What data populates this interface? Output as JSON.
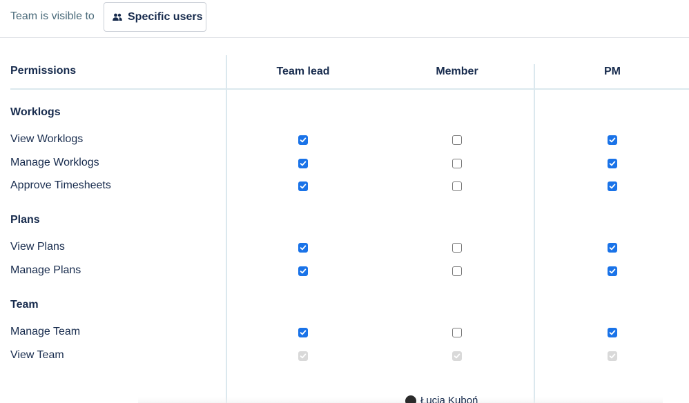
{
  "visibility": {
    "label": "Team is visible to",
    "button_label": "Specific users",
    "button_icon": "users-icon"
  },
  "table": {
    "header": {
      "permissions": "Permissions",
      "columns": [
        "Team lead",
        "Member",
        "PM"
      ]
    },
    "sections": [
      {
        "title": "Worklogs",
        "rows": [
          {
            "label": "View Worklogs",
            "states": [
              "checked",
              "unchecked",
              "checked"
            ]
          },
          {
            "label": "Manage Worklogs",
            "states": [
              "checked",
              "unchecked",
              "checked"
            ]
          },
          {
            "label": "Approve Timesheets",
            "states": [
              "checked",
              "unchecked",
              "checked"
            ]
          }
        ]
      },
      {
        "title": "Plans",
        "rows": [
          {
            "label": "View Plans",
            "states": [
              "checked",
              "unchecked",
              "checked"
            ]
          },
          {
            "label": "Manage Plans",
            "states": [
              "checked",
              "unchecked",
              "checked"
            ]
          }
        ]
      },
      {
        "title": "Team",
        "rows": [
          {
            "label": "Manage Team",
            "states": [
              "checked",
              "unchecked",
              "checked"
            ]
          },
          {
            "label": "View Team",
            "states": [
              "disabled",
              "disabled",
              "disabled"
            ]
          }
        ]
      }
    ]
  },
  "footer": {
    "user_name": "Łucja Kuboń"
  },
  "colors": {
    "checked": "#1a73e8",
    "disabled": "#d9d9d9",
    "divider": "#dbe8ee"
  }
}
